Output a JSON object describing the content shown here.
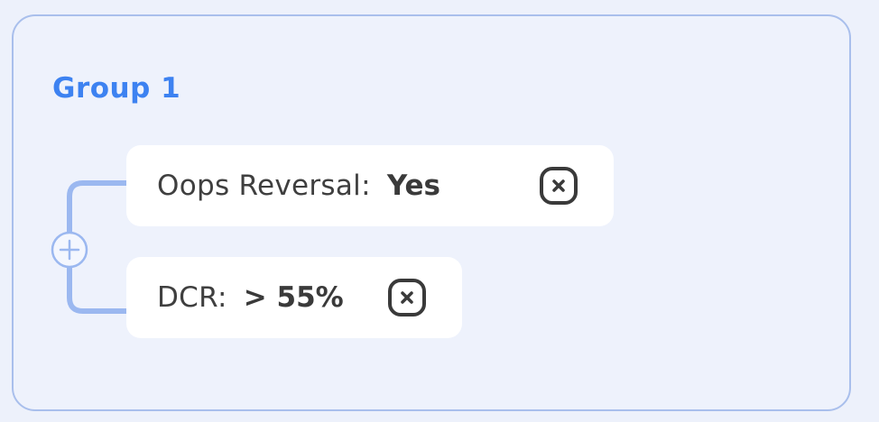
{
  "group": {
    "title": "Group 1",
    "colors": {
      "accent": "#3d82f1",
      "border": "#a9bfec",
      "connector": "#9bb8f0",
      "background": "#eef2fc"
    },
    "add_icon": "plus-circle-icon",
    "conditions": [
      {
        "label": "Oops Reversal:",
        "value": "Yes",
        "remove_icon": "close-square-icon"
      },
      {
        "label": "DCR:",
        "value": "> 55%",
        "remove_icon": "close-square-icon"
      }
    ]
  }
}
